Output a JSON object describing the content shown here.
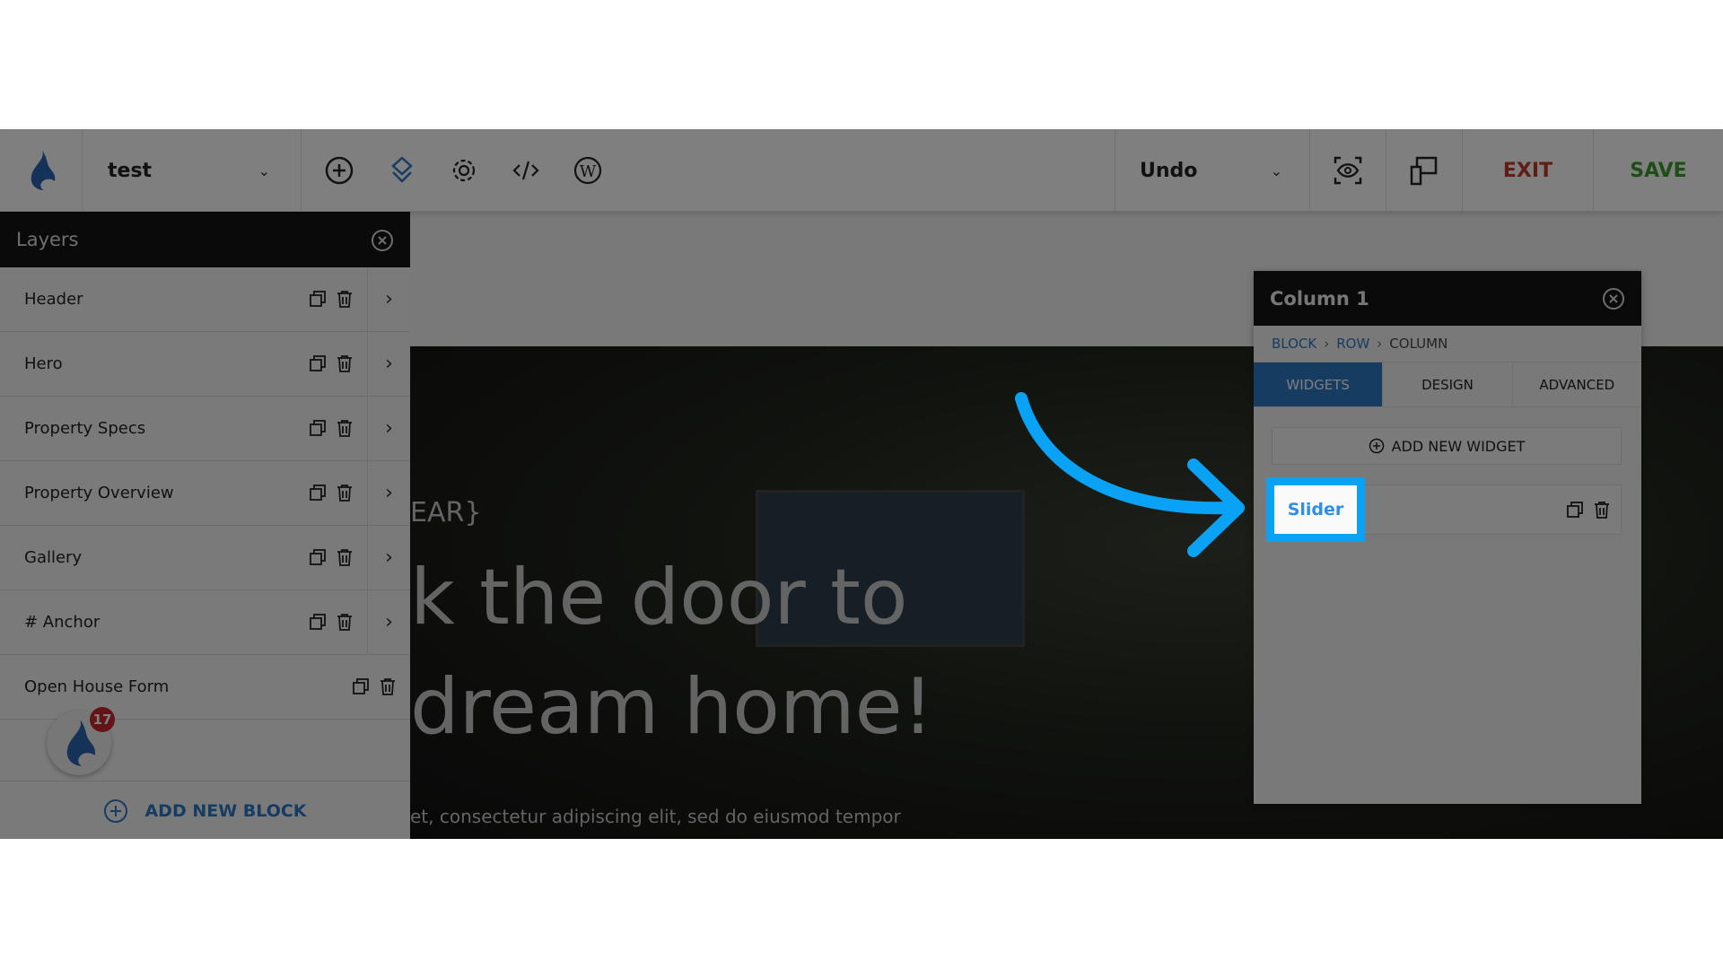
{
  "toolbar": {
    "page_name": "test",
    "undo_label": "Undo",
    "exit_label": "EXIT",
    "save_label": "SAVE",
    "colors": {
      "exit": "#c0392b",
      "save": "#3c9a2f",
      "accent": "#2f78c4"
    },
    "icons": [
      "add-icon",
      "layers-icon",
      "settings-icon",
      "code-icon",
      "wordpress-icon",
      "preview-icon",
      "responsive-icon"
    ]
  },
  "layers": {
    "title": "Layers",
    "items": [
      {
        "label": "Header"
      },
      {
        "label": "Hero"
      },
      {
        "label": "Property Specs"
      },
      {
        "label": "Property Overview"
      },
      {
        "label": "Gallery"
      },
      {
        "label": "# Anchor"
      },
      {
        "label": "Open House Form"
      }
    ],
    "add_block_label": "ADD NEW BLOCK",
    "notification_count": "17"
  },
  "hero": {
    "line0": "EAR}",
    "line1": "k the door to",
    "line2": "dream home!",
    "body": "et, consectetur adipiscing elit, sed do eiusmod tempor"
  },
  "panel": {
    "title": "Column 1",
    "breadcrumb": [
      "BLOCK",
      "ROW",
      "COLUMN"
    ],
    "tabs": [
      "WIDGETS",
      "DESIGN",
      "ADVANCED"
    ],
    "add_widget_label": "ADD NEW WIDGET",
    "widget_label": "Slider"
  }
}
